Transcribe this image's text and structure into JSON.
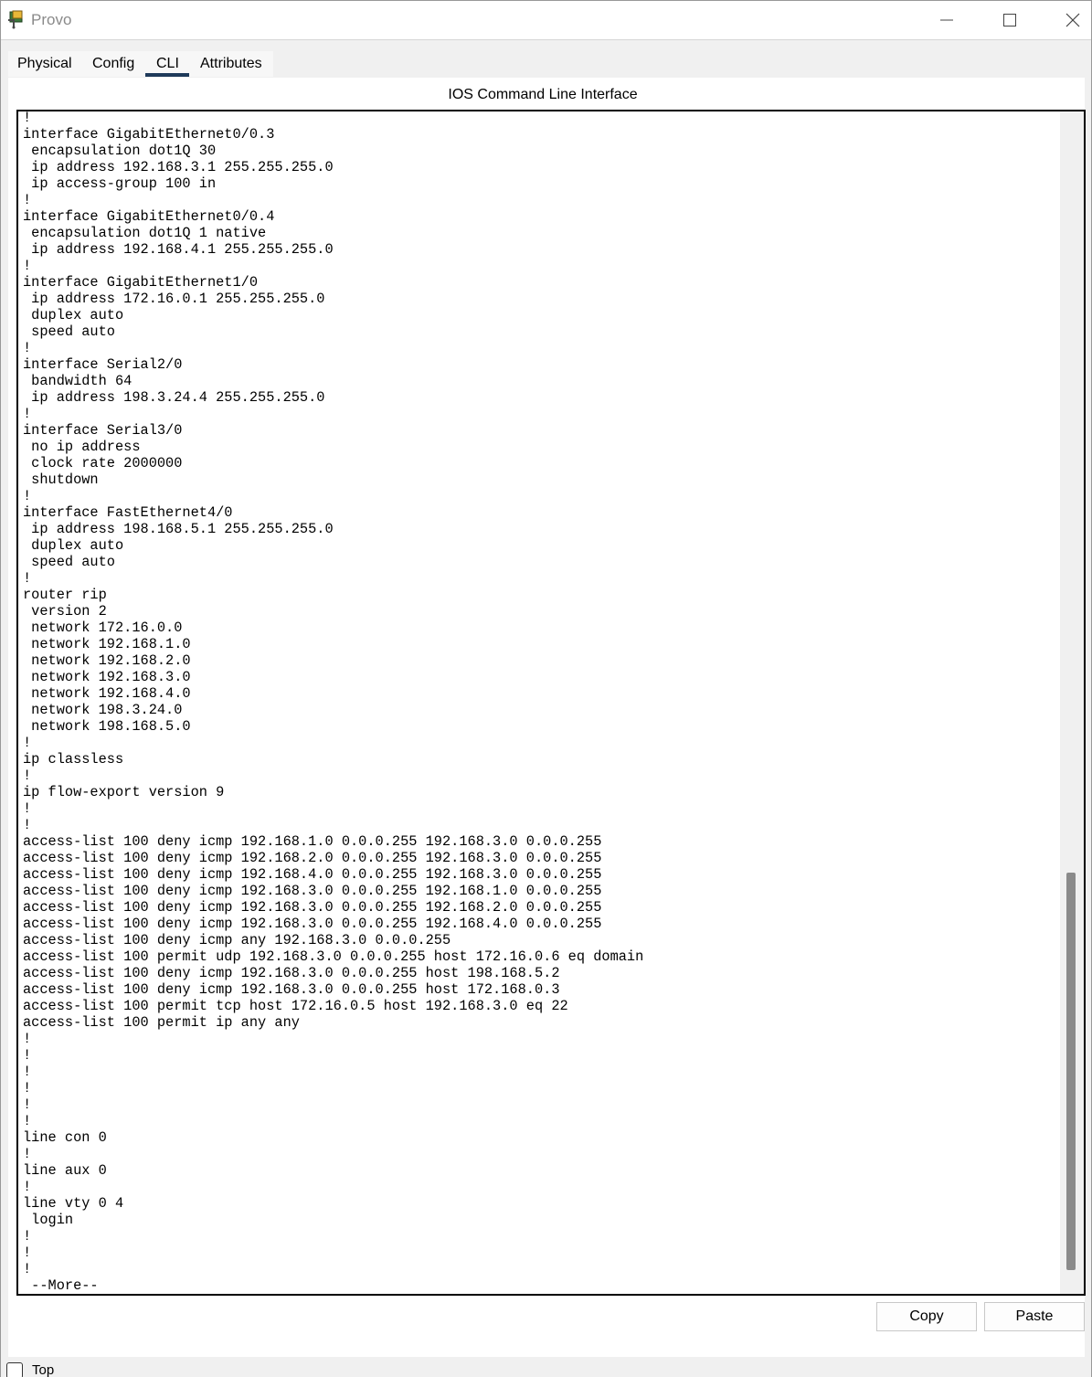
{
  "window": {
    "title": "Provo",
    "icons": {
      "app": "packet-tracer-router-icon",
      "minimize": "minimize-icon",
      "maximize": "maximize-icon",
      "close": "close-icon"
    }
  },
  "tabs": {
    "physical": "Physical",
    "config": "Config",
    "cli": "CLI",
    "attributes": "Attributes",
    "active": "CLI"
  },
  "panel": {
    "title": "IOS Command Line Interface"
  },
  "terminal": {
    "text": "!\ninterface GigabitEthernet0/0.3\n encapsulation dot1Q 30\n ip address 192.168.3.1 255.255.255.0\n ip access-group 100 in\n!\ninterface GigabitEthernet0/0.4\n encapsulation dot1Q 1 native\n ip address 192.168.4.1 255.255.255.0\n!\ninterface GigabitEthernet1/0\n ip address 172.16.0.1 255.255.255.0\n duplex auto\n speed auto\n!\ninterface Serial2/0\n bandwidth 64\n ip address 198.3.24.4 255.255.255.0\n!\ninterface Serial3/0\n no ip address\n clock rate 2000000\n shutdown\n!\ninterface FastEthernet4/0\n ip address 198.168.5.1 255.255.255.0\n duplex auto\n speed auto\n!\nrouter rip\n version 2\n network 172.16.0.0\n network 192.168.1.0\n network 192.168.2.0\n network 192.168.3.0\n network 192.168.4.0\n network 198.3.24.0\n network 198.168.5.0\n!\nip classless\n!\nip flow-export version 9\n!\n!\naccess-list 100 deny icmp 192.168.1.0 0.0.0.255 192.168.3.0 0.0.0.255\naccess-list 100 deny icmp 192.168.2.0 0.0.0.255 192.168.3.0 0.0.0.255\naccess-list 100 deny icmp 192.168.4.0 0.0.0.255 192.168.3.0 0.0.0.255\naccess-list 100 deny icmp 192.168.3.0 0.0.0.255 192.168.1.0 0.0.0.255\naccess-list 100 deny icmp 192.168.3.0 0.0.0.255 192.168.2.0 0.0.0.255\naccess-list 100 deny icmp 192.168.3.0 0.0.0.255 192.168.4.0 0.0.0.255\naccess-list 100 deny icmp any 192.168.3.0 0.0.0.255\naccess-list 100 permit udp 192.168.3.0 0.0.0.255 host 172.16.0.6 eq domain\naccess-list 100 deny icmp 192.168.3.0 0.0.0.255 host 198.168.5.2\naccess-list 100 deny icmp 192.168.3.0 0.0.0.255 host 172.168.0.3\naccess-list 100 permit tcp host 172.16.0.5 host 192.168.3.0 eq 22\naccess-list 100 permit ip any any\n!\n!\n!\n!\n!\n!\nline con 0\n!\nline aux 0\n!\nline vty 0 4\n login\n!\n!\n!\n --More--"
  },
  "buttons": {
    "copy": "Copy",
    "paste": "Paste"
  },
  "footer": {
    "top_label": "Top",
    "top_checked": false
  }
}
